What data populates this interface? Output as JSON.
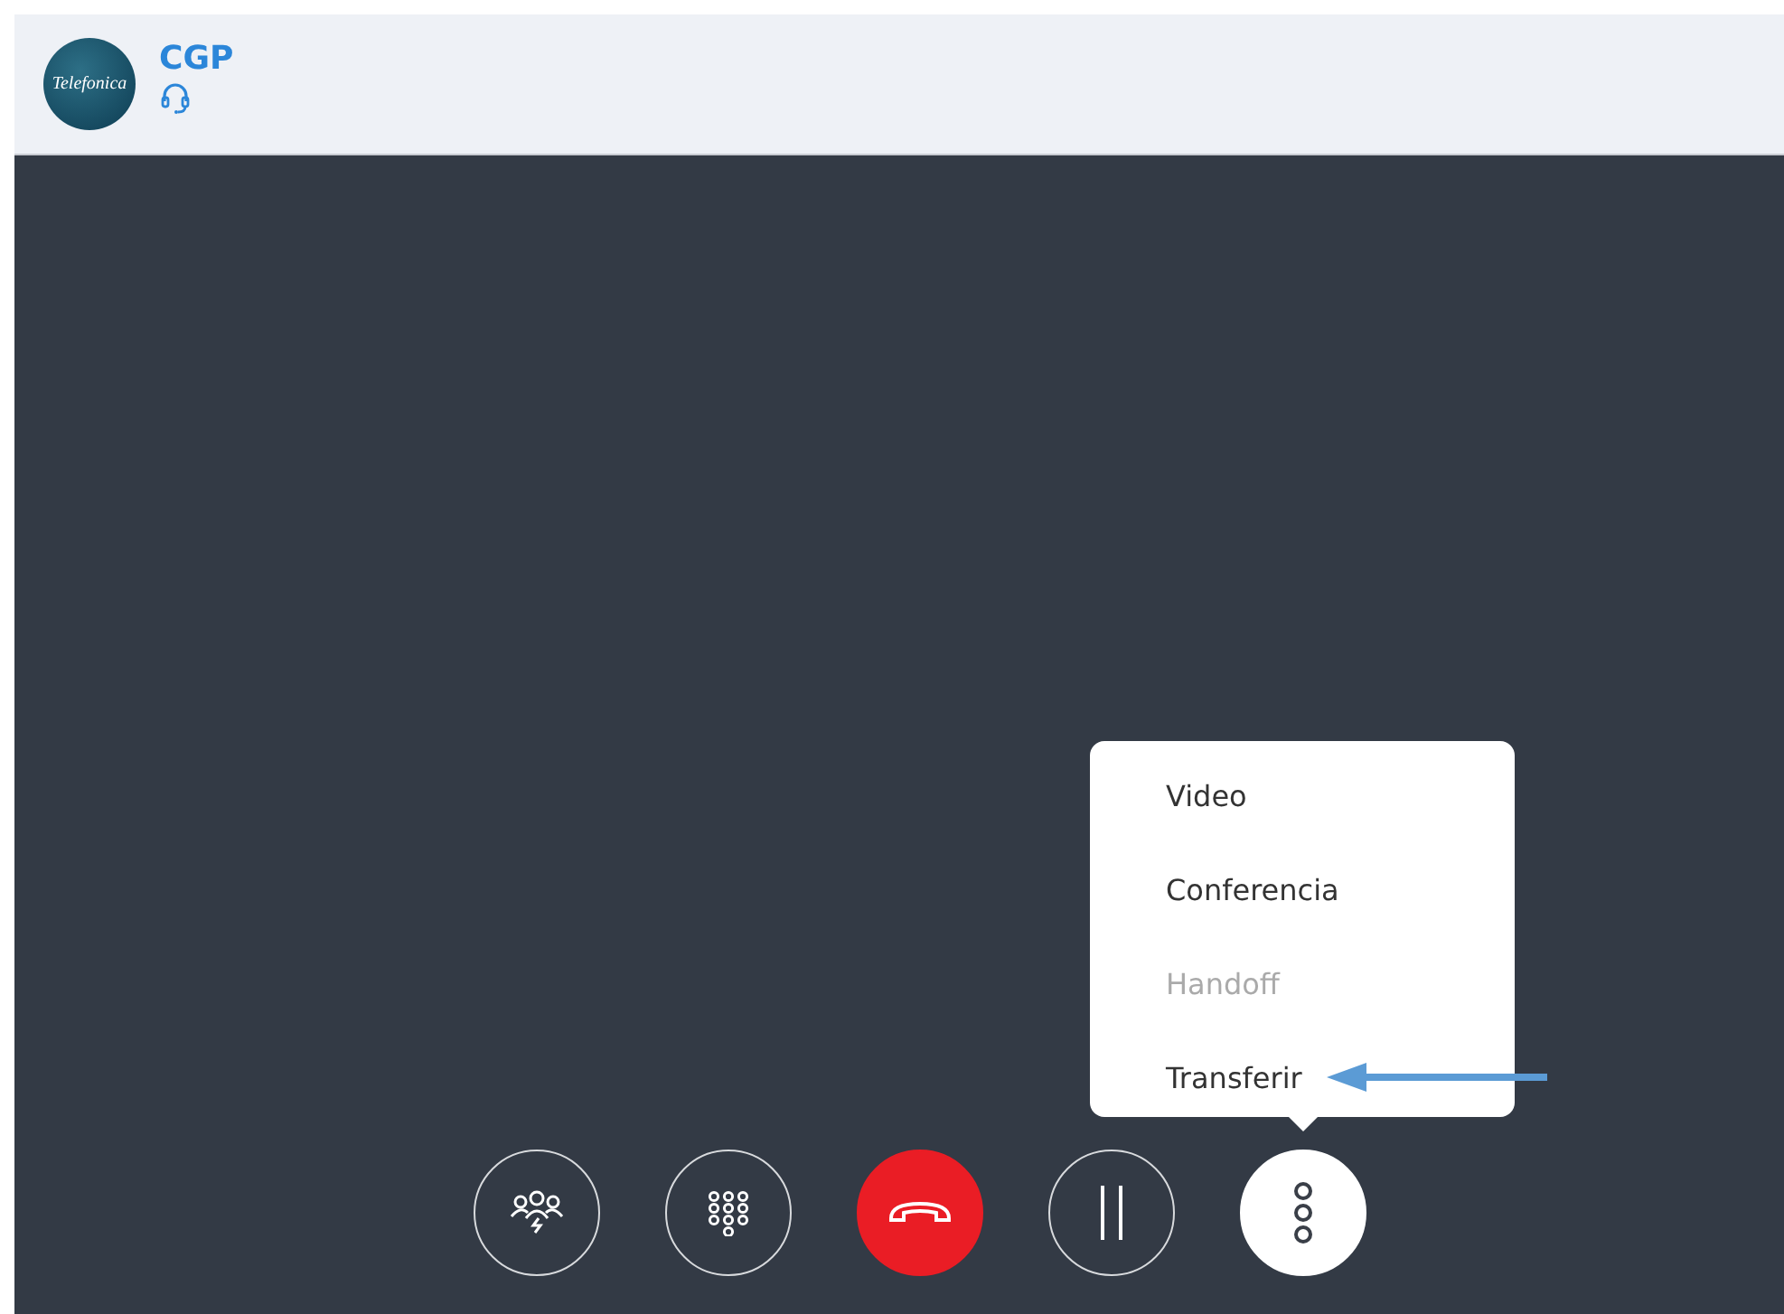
{
  "header": {
    "logo_text": "Telefonica",
    "title": "CGP"
  },
  "controls": [
    {
      "kind": "participants",
      "active": false
    },
    {
      "kind": "dialpad",
      "active": false
    },
    {
      "kind": "hangup",
      "active": false
    },
    {
      "kind": "hold",
      "active": false
    },
    {
      "kind": "more",
      "active": true
    }
  ],
  "menu": {
    "expanded": true,
    "items": [
      {
        "label": "Video",
        "disabled": false,
        "pointed": false
      },
      {
        "label": "Conferencia",
        "disabled": false,
        "pointed": false
      },
      {
        "label": "Handoff",
        "disabled": true,
        "pointed": false
      },
      {
        "label": "Transferir",
        "disabled": false,
        "pointed": true
      }
    ]
  }
}
